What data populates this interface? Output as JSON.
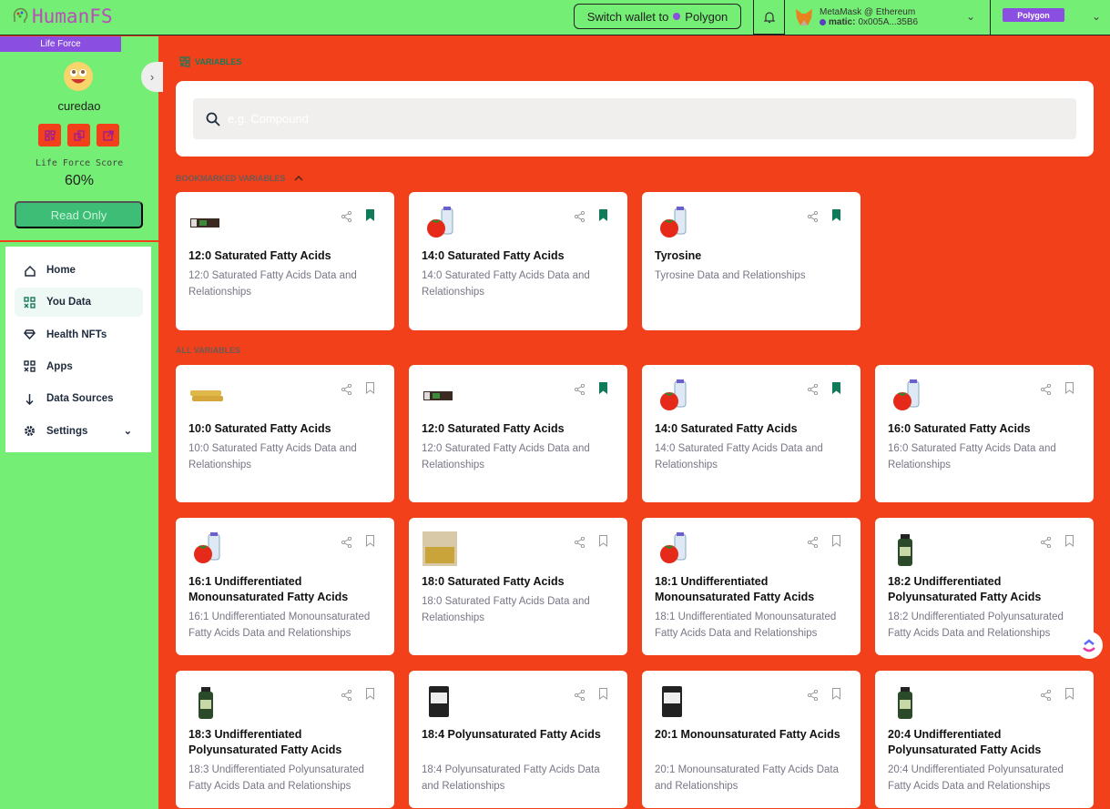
{
  "header": {
    "logo": "HumanFS",
    "switch_wallet": "Switch wallet to",
    "switch_network": "Polygon",
    "wallet_name": "MetaMask @ Ethereum",
    "wallet_prefix": "matic:",
    "wallet_address": "0x005A...35B6",
    "network_badge": "Polygon"
  },
  "sidebar": {
    "life_force_label": "Life Force",
    "username": "curedao",
    "score_label": "Life Force Score",
    "score_value": "60%",
    "read_only": "Read Only",
    "nav": [
      {
        "label": "Home",
        "icon": "home-icon"
      },
      {
        "label": "You Data",
        "icon": "grid-icon",
        "active": true
      },
      {
        "label": "Health NFTs",
        "icon": "diamond-icon"
      },
      {
        "label": "Apps",
        "icon": "apps-icon"
      },
      {
        "label": "Data Sources",
        "icon": "arrow-down-icon"
      },
      {
        "label": "Settings",
        "icon": "gear-icon"
      }
    ]
  },
  "main": {
    "breadcrumb": "VARIABLES",
    "search_placeholder": "e.g. Compound",
    "bookmarked_title": "BOOKMARKED VARIABLES",
    "all_title": "ALL VARIABLES",
    "bookmarked": [
      {
        "title": "12:0 Saturated Fatty Acids",
        "desc": "12:0 Saturated Fatty Acids Data and Relationships",
        "image": "chocolate-bar",
        "bookmarked": true
      },
      {
        "title": "14:0 Saturated Fatty Acids",
        "desc": "14:0 Saturated Fatty Acids Data and Relationships",
        "image": "tomato-milk",
        "bookmarked": true
      },
      {
        "title": "Tyrosine",
        "desc": "Tyrosine Data and Relationships",
        "image": "tomato-milk",
        "bookmarked": true
      }
    ],
    "all": [
      {
        "title": "10:0 Saturated Fatty Acids",
        "desc": "10:0 Saturated Fatty Acids Data and Relationships",
        "image": "snack-bars",
        "bookmarked": false
      },
      {
        "title": "12:0 Saturated Fatty Acids",
        "desc": "12:0 Saturated Fatty Acids Data and Relationships",
        "image": "chocolate-bar",
        "bookmarked": true
      },
      {
        "title": "14:0 Saturated Fatty Acids",
        "desc": "14:0 Saturated Fatty Acids Data and Relationships",
        "image": "tomato-milk",
        "bookmarked": true
      },
      {
        "title": "16:0 Saturated Fatty Acids",
        "desc": "16:0 Saturated Fatty Acids Data and Relationships",
        "image": "tomato-milk",
        "bookmarked": false
      },
      {
        "title": "16:1 Undifferentiated Monounsaturated Fatty Acids",
        "desc": "16:1 Undifferentiated Monounsaturated Fatty Acids Data and Relationships",
        "image": "tomato-milk",
        "bookmarked": false
      },
      {
        "title": "18:0 Saturated Fatty Acids",
        "desc": "18:0 Saturated Fatty Acids Data and Relationships",
        "image": "crate",
        "bookmarked": false
      },
      {
        "title": "18:1 Undifferentiated Monounsaturated Fatty Acids",
        "desc": "18:1 Undifferentiated Monounsaturated Fatty Acids Data and Relationships",
        "image": "tomato-milk",
        "bookmarked": false
      },
      {
        "title": "18:2 Undifferentiated Polyunsaturated Fatty Acids",
        "desc": "18:2 Undifferentiated Polyunsaturated Fatty Acids Data and Relationships",
        "image": "supplement-bottle",
        "bookmarked": false
      },
      {
        "title": "18:3 Undifferentiated Polyunsaturated Fatty Acids",
        "desc": "18:3 Undifferentiated Polyunsaturated Fatty Acids Data and Relationships",
        "image": "supplement-bottle",
        "bookmarked": false
      },
      {
        "title": "18:4 Polyunsaturated Fatty Acids",
        "desc": "18:4 Polyunsaturated Fatty Acids Data and Relationships",
        "image": "protein-tub",
        "bookmarked": false
      },
      {
        "title": "20:1 Monounsaturated Fatty Acids",
        "desc": "20:1 Monounsaturated Fatty Acids Data and Relationships",
        "image": "protein-tub",
        "bookmarked": false
      },
      {
        "title": "20:4 Undifferentiated Polyunsaturated Fatty Acids",
        "desc": "20:4 Undifferentiated Polyunsaturated Fatty Acids Data and Relationships",
        "image": "supplement-bottle",
        "bookmarked": false
      }
    ]
  },
  "colors": {
    "header": "#74ee74",
    "main_bg": "#f2401a",
    "accent": "#0f7b5a",
    "purple": "#8a4fe0"
  }
}
